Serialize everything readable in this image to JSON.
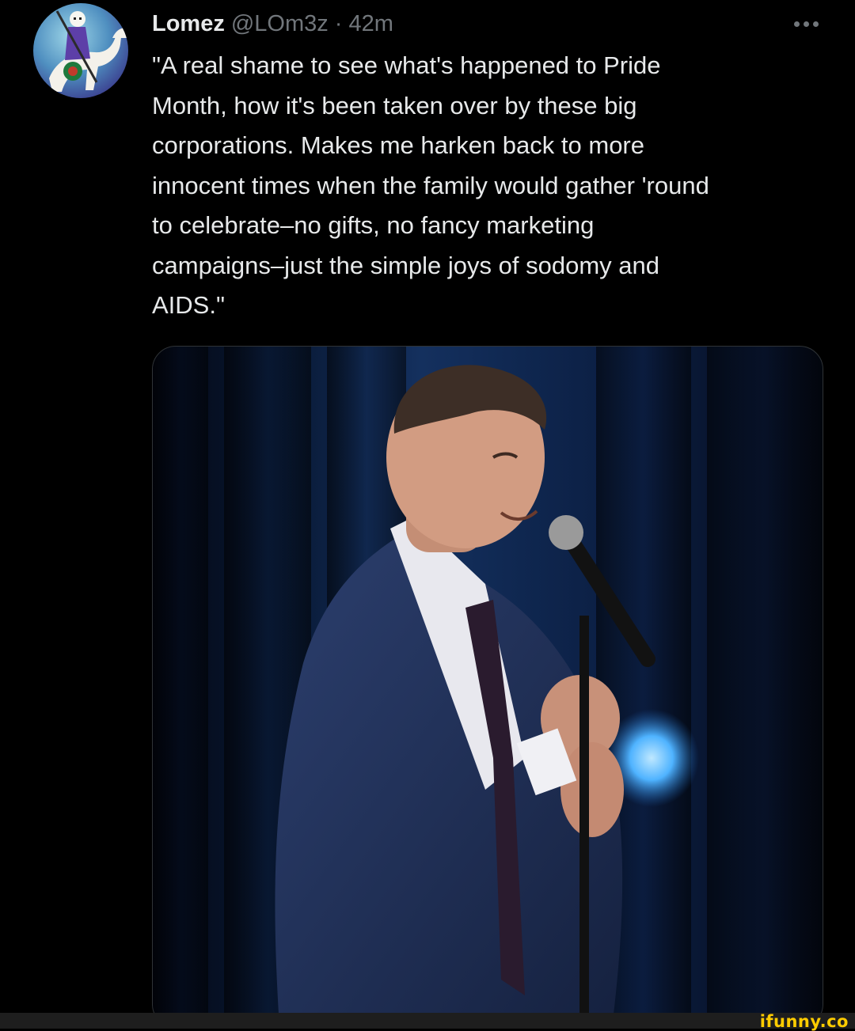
{
  "tweet": {
    "author": {
      "display_name": "Lomez",
      "handle": "@LOm3z",
      "avatar_icon": "skeleton-knight-avatar"
    },
    "separator": "·",
    "time": "42m",
    "more_icon": "ellipsis-icon",
    "text": "\"A real shame to see what's happened to Pride\nMonth, how it's been taken over by these big\ncorporations. Makes me harken back to more\ninnocent times when the family would gather 'round\nto celebrate–no gifts, no fancy marketing\ncampaigns–just the simple joys of sodomy and\nAIDS.\""
  },
  "watermark": "ifunny.co",
  "colors": {
    "background": "#000000",
    "text_primary": "#e7e9ea",
    "text_secondary": "#71767b",
    "watermark": "#ffcc00"
  }
}
